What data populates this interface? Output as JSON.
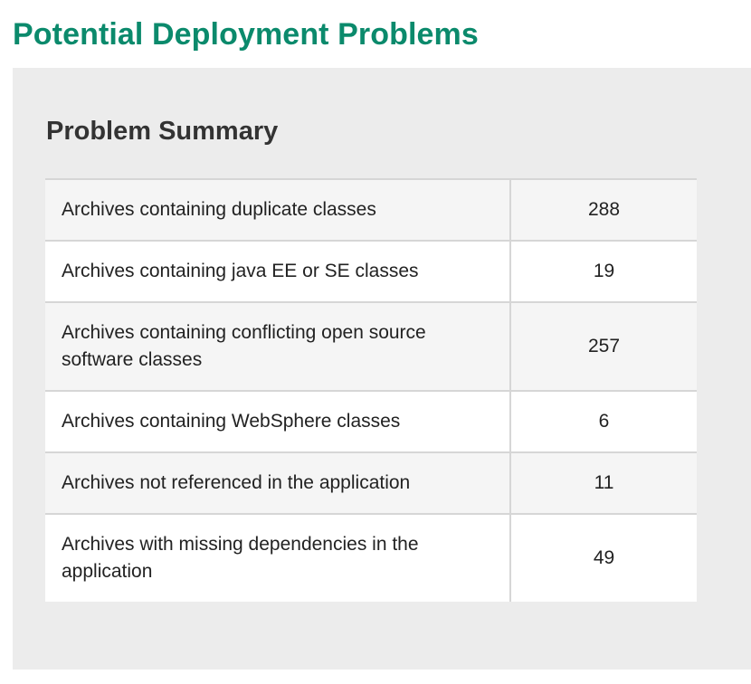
{
  "page": {
    "title": "Potential Deployment Problems"
  },
  "summary": {
    "heading": "Problem Summary",
    "rows": [
      {
        "label": "Archives containing duplicate classes",
        "value": "288"
      },
      {
        "label": "Archives containing java EE or SE classes",
        "value": "19"
      },
      {
        "label": "Archives containing conflicting open source software classes",
        "value": "257"
      },
      {
        "label": "Archives containing WebSphere classes",
        "value": "6"
      },
      {
        "label": "Archives not referenced in the application",
        "value": "11"
      },
      {
        "label": "Archives with missing dependencies in the application",
        "value": "49"
      }
    ]
  },
  "colors": {
    "title": "#0b8a6c",
    "panel_background": "#ececec",
    "row_shaded": "#f5f5f5",
    "row_plain": "#ffffff",
    "border": "#d6d6d6"
  }
}
